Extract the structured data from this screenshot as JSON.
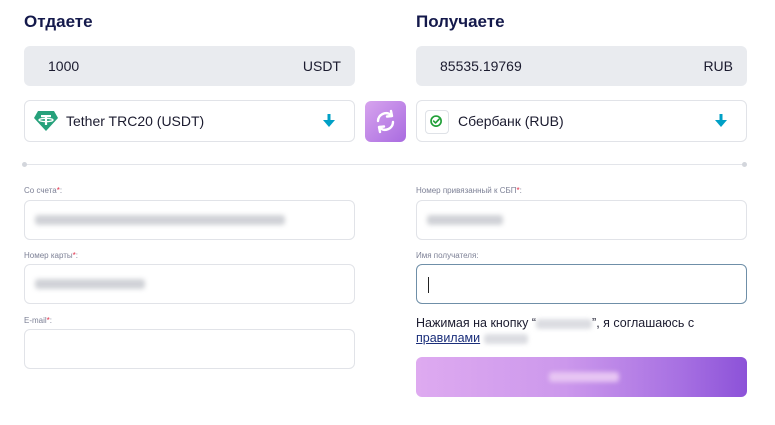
{
  "give": {
    "title": "Отдаете",
    "amount": "1000",
    "currency": "USDT",
    "method": "Tether TRC20 (USDT)",
    "method_icon": "tether-icon"
  },
  "get": {
    "title": "Получаете",
    "amount": "85535.19769",
    "currency": "RUB",
    "method": "Сбербанк (RUB)",
    "method_icon": "sberbank-icon"
  },
  "form": {
    "from_account_label": "Со счета",
    "card_number_label": "Номер карты",
    "email_label": "E-mail",
    "sbp_phone_label": "Номер привязанный к СБП",
    "recipient_name_label": "Имя получателя",
    "required_mark": "*",
    "recipient_name_label_suffix": ":",
    "label_suffix": ":"
  },
  "agreement": {
    "prefix": "Нажимая на кнопку “",
    "suffix": "”, я соглашаюсь с",
    "link": "правилами"
  },
  "colors": {
    "title": "#14194b",
    "accent_teal": "#00a0c6",
    "button_gradient_start": "#deaaf0",
    "button_gradient_end": "#8c52d8",
    "required": "#e0314b"
  }
}
